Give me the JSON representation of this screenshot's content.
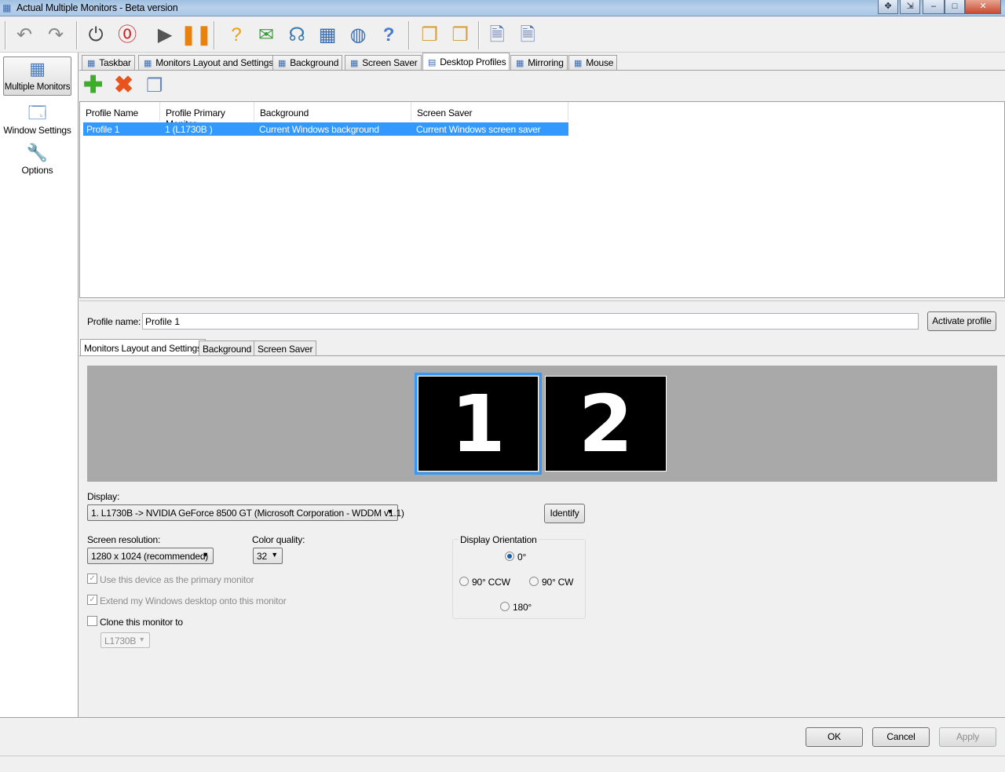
{
  "window": {
    "title": "Actual Multiple Monitors - Beta version",
    "minimize": "–",
    "maximize": "□",
    "close": "✕"
  },
  "toolbar": {
    "icons": [
      "undo-icon",
      "redo-icon",
      "power-icon",
      "stop-icon",
      "play-icon",
      "pause-icon",
      "help-topics-icon",
      "send-feedback-icon",
      "support-icon",
      "multiple-monitors-icon",
      "website-icon",
      "help-icon",
      "import-icon",
      "export-icon",
      "settings-icon",
      "user-settings-icon"
    ]
  },
  "sidebar": {
    "items": [
      {
        "label": "Multiple Monitors",
        "selected": true
      },
      {
        "label": "Window Settings"
      },
      {
        "label": "Options"
      }
    ]
  },
  "tabs": [
    {
      "label": "Taskbar"
    },
    {
      "label": "Monitors Layout and Settings"
    },
    {
      "label": "Background"
    },
    {
      "label": "Screen Saver"
    },
    {
      "label": "Desktop Profiles",
      "selected": true
    },
    {
      "label": "Mirroring"
    },
    {
      "label": "Mouse"
    }
  ],
  "profiles": {
    "actions": [
      "add-icon",
      "delete-icon",
      "copy-icon"
    ],
    "columns": [
      "Profile Name",
      "Profile Primary Monitor",
      "Background",
      "Screen Saver"
    ],
    "rows": [
      [
        "Profile 1",
        "1 (L1730B )",
        "Current Windows background",
        "Current Windows screen saver"
      ]
    ]
  },
  "profile_name": {
    "label": "Profile name:",
    "value": "Profile 1",
    "activate": "Activate profile"
  },
  "inner_tabs": [
    {
      "label": "Monitors Layout and Settings",
      "selected": true
    },
    {
      "label": "Background"
    },
    {
      "label": "Screen Saver"
    }
  ],
  "monitors": [
    "1",
    "2"
  ],
  "display": {
    "label": "Display:",
    "value": "1. L1730B  -> NVIDIA GeForce 8500 GT (Microsoft Corporation - WDDM v1.1)",
    "identify": "Identify"
  },
  "resolution": {
    "label": "Screen resolution:",
    "value": "1280 x 1024 (recommended)"
  },
  "color": {
    "label": "Color quality:",
    "value": "32"
  },
  "checks": {
    "primary": {
      "label": "Use this device as the primary monitor",
      "checked": true,
      "disabled": true
    },
    "extend": {
      "label": "Extend my Windows desktop onto this monitor",
      "checked": true,
      "disabled": true
    },
    "clone": {
      "label": "Clone this monitor to",
      "checked": false
    },
    "clone_target": "L1730B"
  },
  "orientation": {
    "label": "Display Orientation",
    "options": [
      "0°",
      "90° CCW",
      "90° CW",
      "180°"
    ],
    "selected": "0°"
  },
  "footer": {
    "ok": "OK",
    "cancel": "Cancel",
    "apply": "Apply"
  },
  "colors": {
    "selection": "#3399ff",
    "monitor_area": "#a9a9a9"
  }
}
